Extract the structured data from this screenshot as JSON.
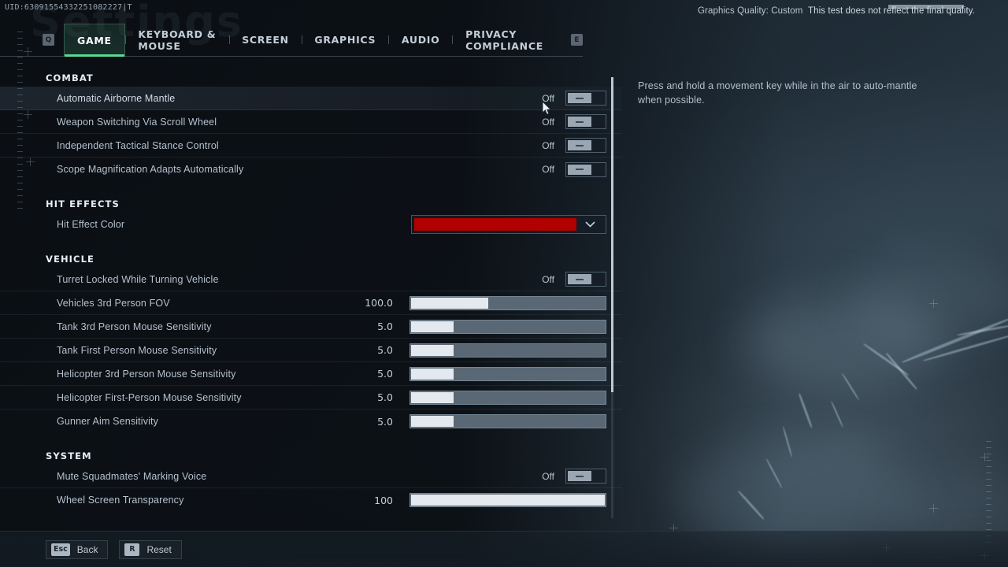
{
  "topbar": {
    "uid": "UID:63091554332251082227|T",
    "graphics_quality": "Graphics Quality: Custom",
    "final_note": "This test does not reflect the final quality."
  },
  "watermark": "Settings",
  "tabs": {
    "prev_key": "Q",
    "next_key": "E",
    "items": [
      {
        "label": "GAME",
        "active": true
      },
      {
        "label": "KEYBOARD & MOUSE",
        "active": false
      },
      {
        "label": "SCREEN",
        "active": false
      },
      {
        "label": "GRAPHICS",
        "active": false
      },
      {
        "label": "AUDIO",
        "active": false
      },
      {
        "label": "PRIVACY COMPLIANCE",
        "active": false
      }
    ]
  },
  "sections": [
    {
      "title": "COMBAT",
      "rows": [
        {
          "label": "Automatic Airborne Mantle",
          "type": "toggle",
          "state": "Off",
          "highlight": true
        },
        {
          "label": "Weapon Switching Via Scroll Wheel",
          "type": "toggle",
          "state": "Off"
        },
        {
          "label": "Independent Tactical Stance Control",
          "type": "toggle",
          "state": "Off"
        },
        {
          "label": "Scope Magnification Adapts Automatically",
          "type": "toggle",
          "state": "Off"
        }
      ]
    },
    {
      "title": "HIT EFFECTS",
      "rows": [
        {
          "label": "Hit Effect Color",
          "type": "color",
          "color": "#b00000",
          "chevron": "chevron-down"
        }
      ]
    },
    {
      "title": "VEHICLE",
      "rows": [
        {
          "label": "Turret Locked While Turning Vehicle",
          "type": "toggle",
          "state": "Off"
        },
        {
          "label": "Vehicles 3rd Person FOV",
          "type": "slider",
          "value": "100.0",
          "fill_pct": 40
        },
        {
          "label": "Tank 3rd Person Mouse Sensitivity",
          "type": "slider",
          "value": "5.0",
          "fill_pct": 22
        },
        {
          "label": "Tank First Person Mouse Sensitivity",
          "type": "slider",
          "value": "5.0",
          "fill_pct": 22
        },
        {
          "label": "Helicopter 3rd Person Mouse Sensitivity",
          "type": "slider",
          "value": "5.0",
          "fill_pct": 22
        },
        {
          "label": "Helicopter First-Person Mouse Sensitivity",
          "type": "slider",
          "value": "5.0",
          "fill_pct": 22
        },
        {
          "label": "Gunner Aim Sensitivity",
          "type": "slider",
          "value": "5.0",
          "fill_pct": 22
        }
      ]
    },
    {
      "title": "SYSTEM",
      "rows": [
        {
          "label": "Mute Squadmates' Marking Voice",
          "type": "toggle",
          "state": "Off"
        },
        {
          "label": "Wheel Screen Transparency",
          "type": "slider",
          "value": "100",
          "fill_pct": 100
        }
      ]
    }
  ],
  "description": "Press and hold a movement key while in the air to auto-mantle when possible.",
  "bottombar": [
    {
      "key": "Esc",
      "label": "Back"
    },
    {
      "key": "R",
      "label": "Reset"
    }
  ],
  "colors": {
    "accent_green": "#5ad894",
    "hit_effect_red": "#b00000"
  }
}
